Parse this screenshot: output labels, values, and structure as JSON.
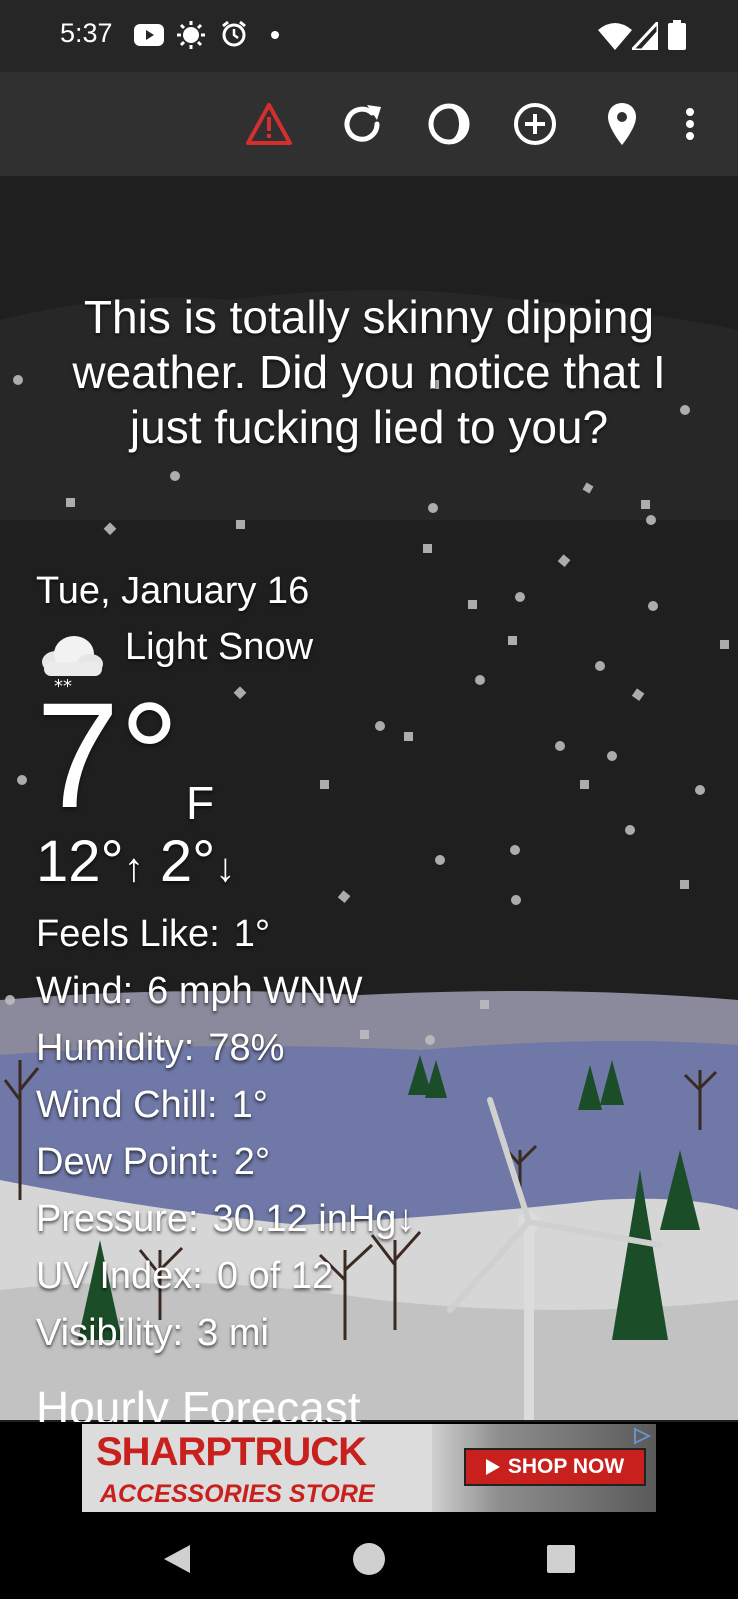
{
  "status_bar": {
    "time": "5:37",
    "icons": [
      "youtube-icon",
      "brightness-icon",
      "alarm-icon",
      "notification-dot-icon",
      "wifi-icon",
      "cell-signal-icon",
      "battery-icon"
    ]
  },
  "toolbar": {
    "icons": [
      "alert-icon",
      "refresh-icon",
      "theme-icon",
      "add-location-icon",
      "location-pin-icon",
      "more-icon"
    ],
    "alert_color": "#d32f2f"
  },
  "quote": "This is totally skinny dipping weather. Did you notice that I just fucking lied to you?",
  "weather": {
    "date": "Tue, January 16",
    "condition": "Light Snow",
    "condition_icon": "light-snow-icon",
    "temperature": "7°",
    "unit": "F",
    "high": "12°",
    "low": "2°",
    "details": [
      {
        "label": "Feels Like:",
        "value": "1°"
      },
      {
        "label": "Wind:",
        "value": "6 mph WNW"
      },
      {
        "label": "Humidity:",
        "value": "78%"
      },
      {
        "label": "Wind Chill:",
        "value": "1°"
      },
      {
        "label": "Dew Point:",
        "value": "2°"
      },
      {
        "label": "Pressure:",
        "value": "30.12 inHg↓"
      },
      {
        "label": "UV Index:",
        "value": "0 of 12"
      },
      {
        "label": "Visibility:",
        "value": "3 mi"
      }
    ],
    "next_section": "Hourly Forecast"
  },
  "ad": {
    "brand": "SHARPTRUCK",
    "subtitle": "ACCESSORIES STORE",
    "cta": "SHOP NOW",
    "accent": "#c8201c"
  },
  "nav_bar": {
    "icons": [
      "back-icon",
      "home-icon",
      "recents-icon"
    ]
  }
}
